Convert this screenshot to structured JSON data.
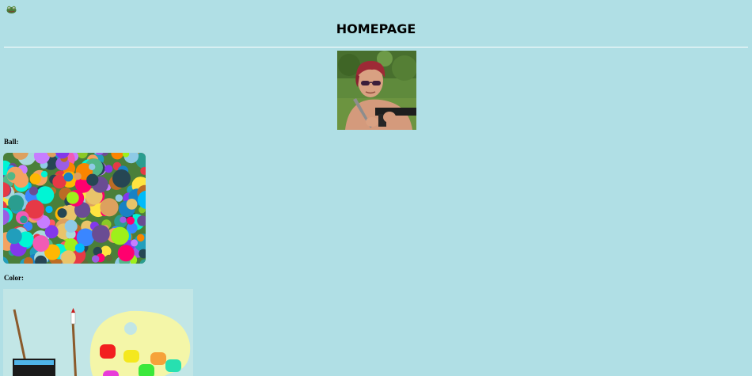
{
  "header": {
    "title": "HOMEPAGE",
    "icon": "frog-icon"
  },
  "profile": {
    "image": "profile-photo"
  },
  "sections": {
    "ball": {
      "label": "Ball:"
    },
    "color": {
      "label": "Color:"
    }
  },
  "colors": {
    "background": "#b0dfe5",
    "rule": "#ffffff",
    "palette_board": "#f4f6a8"
  }
}
